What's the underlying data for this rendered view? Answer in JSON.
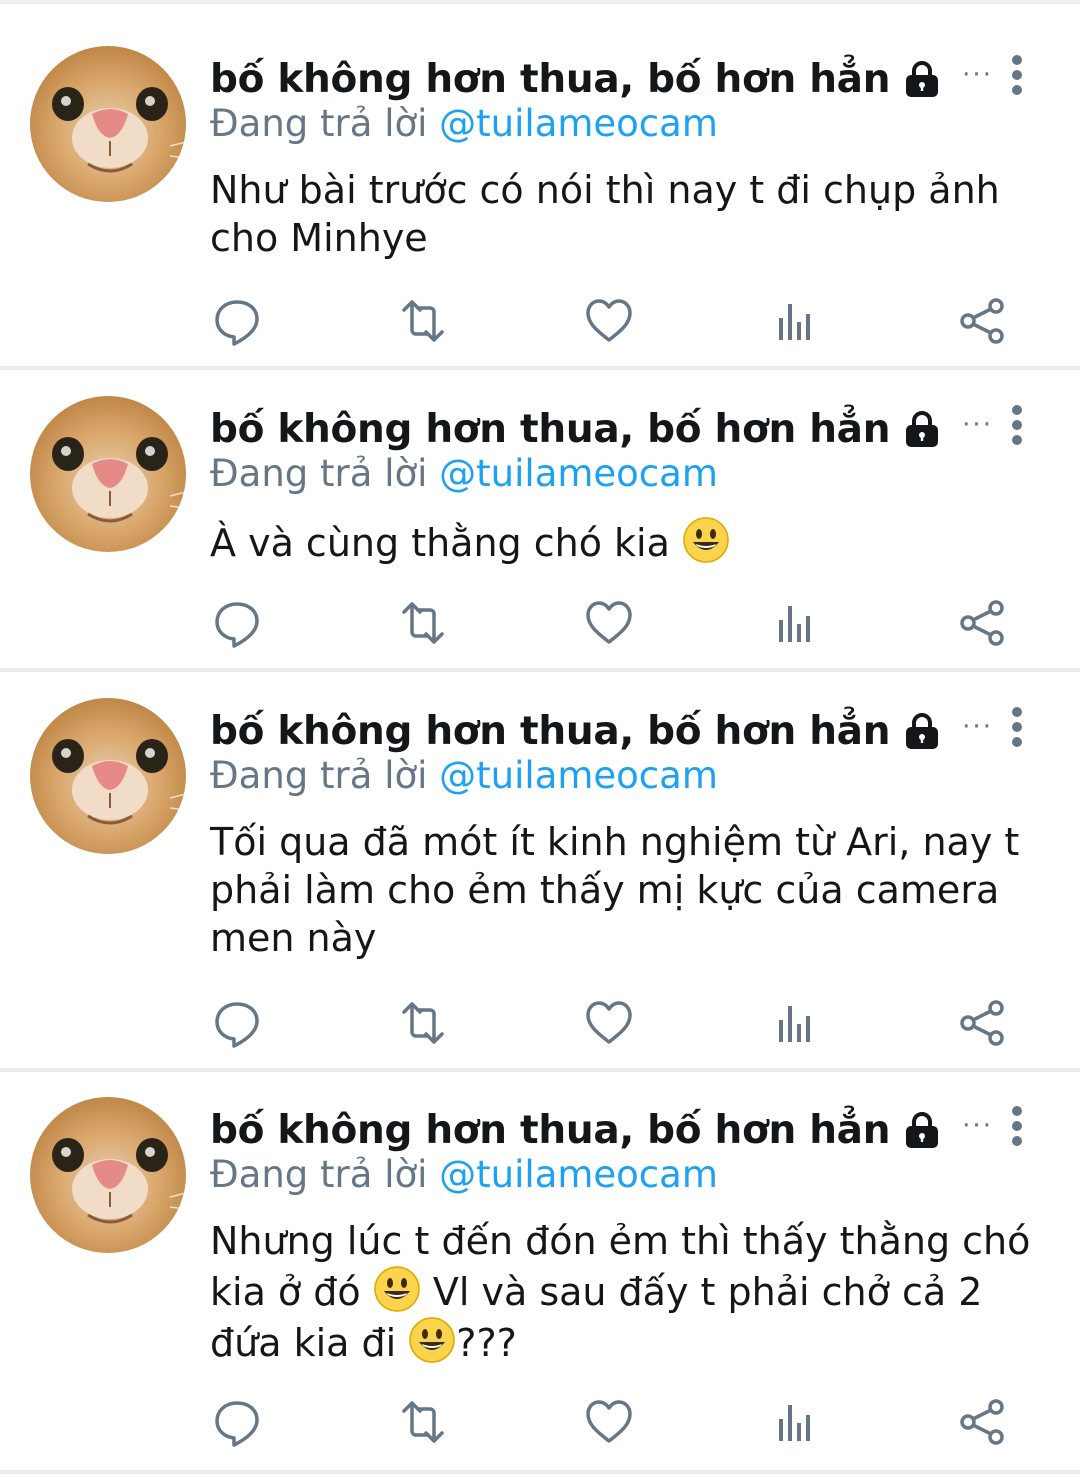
{
  "colors": {
    "text": "#14171a",
    "secondary": "#657786",
    "link": "#1da1f2",
    "separator": "#e8ecef"
  },
  "icons": {
    "lock": "lock-icon",
    "more": "more-vertical-icon",
    "reply": "reply-icon",
    "retweet": "retweet-icon",
    "like": "heart-icon",
    "analytics": "analytics-icon",
    "share": "share-icon",
    "emoji": "smiley-emoji"
  },
  "tweets": [
    {
      "display_name": "bố không hơn thua, bố hơn hẳn",
      "name_suffix": "···",
      "replying_label": "Đang trả lời",
      "reply_handle": "@tuilameocam",
      "body": "Như bài trước có nói thì nay t đi chụp ảnh cho Minhye"
    },
    {
      "display_name": "bố không hơn thua, bố hơn hẳn",
      "name_suffix": "···",
      "replying_label": "Đang trả lời",
      "reply_handle": "@tuilameocam",
      "body": "À và cùng thằng chó kia"
    },
    {
      "display_name": "bố không hơn thua, bố hơn hẳn",
      "name_suffix": "···",
      "replying_label": "Đang trả lời",
      "reply_handle": "@tuilameocam",
      "body": "Tối qua đã mót ít kinh nghiệm từ Ari, nay t phải làm cho ẻm thấy mị kực của camera men này"
    },
    {
      "display_name": "bố không hơn thua, bố hơn hẳn",
      "name_suffix": "···",
      "replying_label": "Đang trả lời",
      "reply_handle": "@tuilameocam",
      "body_part_1": "Nhưng lúc t đến đón ẻm thì thấy thằng chó kia ở đó",
      "body_part_2": "Vl và sau đấy t phải chở cả 2 đứa kia đi",
      "body_part_3": "???"
    }
  ]
}
